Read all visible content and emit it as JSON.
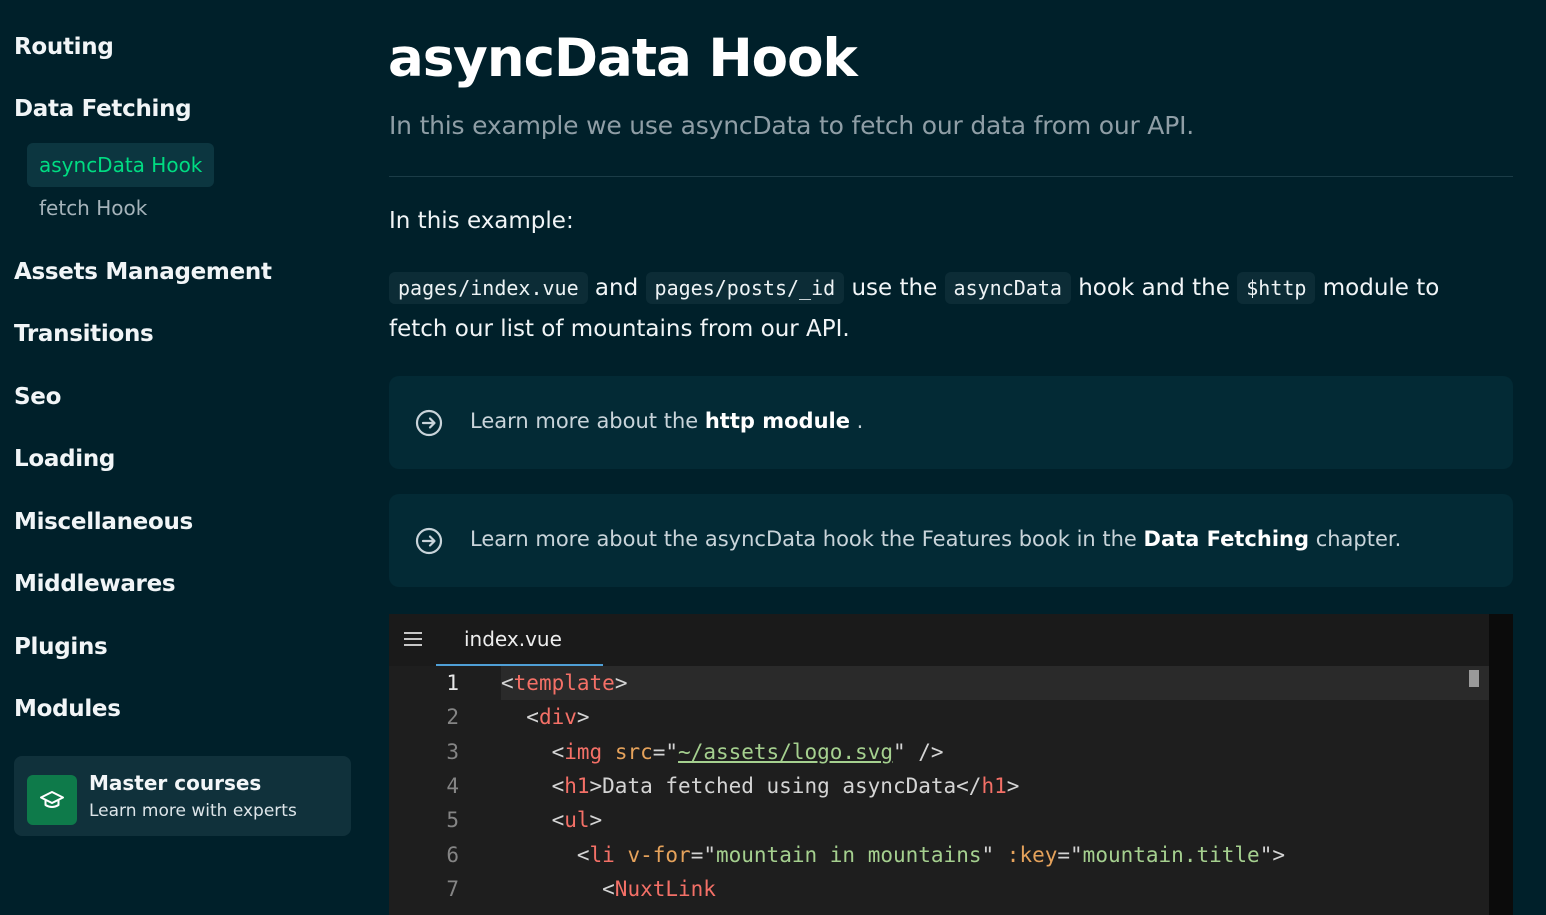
{
  "sidebar": {
    "items": [
      {
        "label": "Routing"
      },
      {
        "label": "Data Fetching"
      },
      {
        "label": "Assets Management"
      },
      {
        "label": "Transitions"
      },
      {
        "label": "Seo"
      },
      {
        "label": "Loading"
      },
      {
        "label": "Miscellaneous"
      },
      {
        "label": "Middlewares"
      },
      {
        "label": "Plugins"
      },
      {
        "label": "Modules"
      }
    ],
    "sub_items": [
      {
        "label": "asyncData Hook",
        "active": true
      },
      {
        "label": "fetch Hook",
        "active": false
      }
    ],
    "promo": {
      "title": "Master courses",
      "subtitle": "Learn more with experts",
      "icon": "graduation-cap-icon"
    }
  },
  "main": {
    "title": "asyncData Hook",
    "subtitle": "In this example we use asyncData to fetch our data from our API.",
    "intro": "In this example:",
    "paragraph": {
      "code1": "pages/index.vue",
      "text1": " and ",
      "code2": "pages/posts/_id",
      "text2": " use the ",
      "code3": "asyncData",
      "text3": " hook and the ",
      "code4": "$http",
      "text4": " module to",
      "text5": "fetch our list of mountains from our API."
    },
    "callouts": [
      {
        "before": "Learn more about the ",
        "link": "http module",
        "after": " .",
        "icon": "arrow-circle-right-icon"
      },
      {
        "before": "Learn more about the asyncData hook the Features book in the ",
        "link": "Data Fetching",
        "after": " chapter.",
        "icon": "arrow-circle-right-icon"
      }
    ]
  },
  "code_panel": {
    "menu_icon": "hamburger-menu-icon",
    "file_tab": "index.vue",
    "current_line": 1,
    "lines": [
      {
        "n": "1",
        "p": [
          "<",
          "template",
          ">"
        ]
      },
      {
        "n": "2",
        "p": [
          "  <",
          "div",
          ">"
        ]
      },
      {
        "n": "3",
        "p": [
          "    <",
          "img",
          " ",
          "src",
          "=\"",
          "~/assets/logo.svg",
          "\" />"
        ]
      },
      {
        "n": "4",
        "p": [
          "    <",
          "h1",
          ">Data fetched using asyncData</",
          "h1",
          ">"
        ]
      },
      {
        "n": "5",
        "p": [
          "    <",
          "ul",
          ">"
        ]
      },
      {
        "n": "6",
        "p": [
          "      <",
          "li",
          " ",
          "v-for",
          "=\"",
          "mountain in mountains",
          "\" ",
          ":key",
          "=\"",
          "mountain.title",
          "\">"
        ]
      },
      {
        "n": "7",
        "p": [
          "        <",
          "NuxtLink"
        ]
      }
    ]
  },
  "colors": {
    "background": "#00202a",
    "accent_green": "#00dc82",
    "callout_bg": "#032a35",
    "code_bg": "#1e1e1e"
  }
}
